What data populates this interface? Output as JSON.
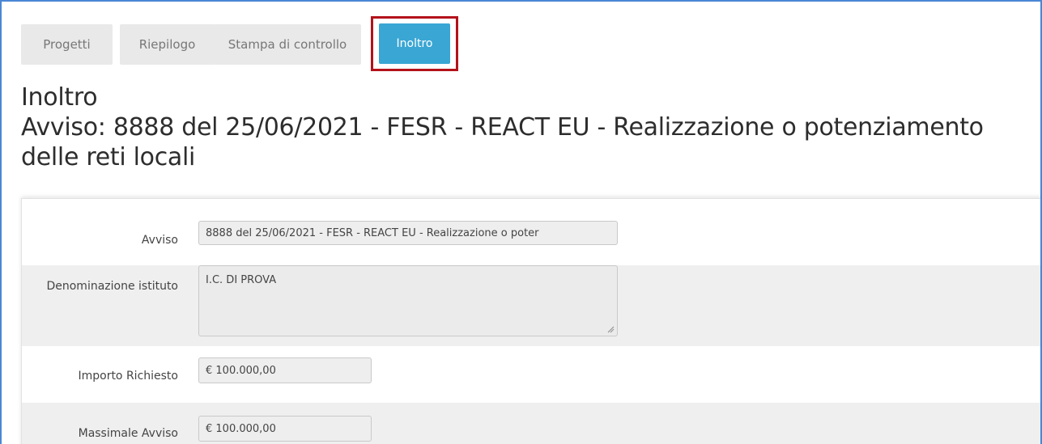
{
  "tabs": {
    "progetti": "Progetti",
    "riepilogo": "Riepilogo",
    "stampa": "Stampa di controllo",
    "inoltro": "Inoltro"
  },
  "heading": {
    "title": "Inoltro",
    "subtitle": "Avviso: 8888 del 25/06/2021 - FESR - REACT EU - Realizzazione o potenziamento delle reti locali"
  },
  "form": {
    "avviso_label": "Avviso",
    "avviso_value": "8888 del 25/06/2021 - FESR - REACT EU - Realizzazione o poter",
    "denominazione_label": "Denominazione istituto",
    "denominazione_value": "I.C. DI PROVA",
    "importo_label": "Importo Richiesto",
    "importo_value": "€ 100.000,00",
    "massimale_label": "Massimale Avviso",
    "massimale_value": "€ 100.000,00"
  },
  "colors": {
    "active_tab": "#3aa6d4",
    "highlight_border": "#b3121b",
    "frame_border": "#4a86d4"
  }
}
